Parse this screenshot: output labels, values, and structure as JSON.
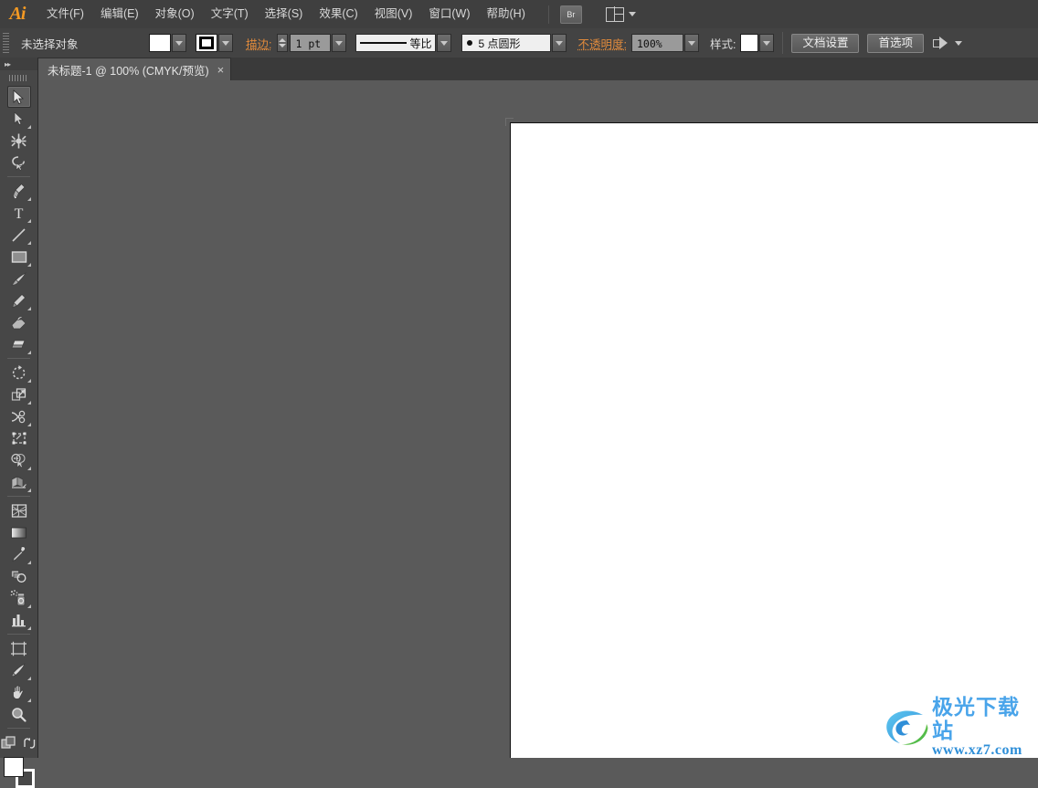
{
  "app": {
    "name": "Adobe Illustrator",
    "logo_text": "Ai"
  },
  "menubar": {
    "items": [
      {
        "label": "文件(F)",
        "name": "menu-file"
      },
      {
        "label": "编辑(E)",
        "name": "menu-edit"
      },
      {
        "label": "对象(O)",
        "name": "menu-object"
      },
      {
        "label": "文字(T)",
        "name": "menu-type"
      },
      {
        "label": "选择(S)",
        "name": "menu-select"
      },
      {
        "label": "效果(C)",
        "name": "menu-effect"
      },
      {
        "label": "视图(V)",
        "name": "menu-view"
      },
      {
        "label": "窗口(W)",
        "name": "menu-window"
      },
      {
        "label": "帮助(H)",
        "name": "menu-help"
      }
    ],
    "bridge_label": "Br",
    "workspace_label": ""
  },
  "controlbar": {
    "selection_status": "未选择对象",
    "fill_color": "#ffffff",
    "stroke_color": "#000000",
    "stroke_label": "描边:",
    "stroke_weight": "1 pt",
    "stroke_profile": "等比",
    "brush_definition": "5 点圆形",
    "opacity_label": "不透明度:",
    "opacity_value": "100%",
    "style_label": "样式:",
    "style_color": "#ffffff",
    "document_setup_button": "文档设置",
    "preferences_button": "首选项"
  },
  "tabbar": {
    "tabs": [
      {
        "title": "未标题-1 @ 100% (CMYK/预览)",
        "close": "×"
      }
    ]
  },
  "toolbar": {
    "collapse_arrows": "▸▸",
    "tools": [
      {
        "name": "selection-tool",
        "label": "选择工具",
        "selected": true,
        "hidden": false
      },
      {
        "name": "direct-selection-tool",
        "label": "直接选择工具",
        "selected": false,
        "hidden": true
      },
      {
        "name": "magic-wand-tool",
        "label": "魔棒工具",
        "selected": false,
        "hidden": false
      },
      {
        "name": "lasso-tool",
        "label": "套索工具",
        "selected": false,
        "hidden": false
      },
      {
        "name": "pen-tool",
        "label": "钢笔工具",
        "selected": false,
        "hidden": true
      },
      {
        "name": "type-tool",
        "label": "文字工具",
        "selected": false,
        "hidden": true
      },
      {
        "name": "line-segment-tool",
        "label": "直线段工具",
        "selected": false,
        "hidden": true
      },
      {
        "name": "rectangle-tool",
        "label": "矩形工具",
        "selected": false,
        "hidden": true
      },
      {
        "name": "paintbrush-tool",
        "label": "画笔工具",
        "selected": false,
        "hidden": false
      },
      {
        "name": "pencil-tool",
        "label": "铅笔工具",
        "selected": false,
        "hidden": true
      },
      {
        "name": "blob-brush-tool",
        "label": "斑点画笔工具",
        "selected": false,
        "hidden": false
      },
      {
        "name": "eraser-tool",
        "label": "橡皮擦工具",
        "selected": false,
        "hidden": true
      },
      {
        "name": "rotate-tool",
        "label": "旋转工具",
        "selected": false,
        "hidden": true
      },
      {
        "name": "scale-tool",
        "label": "比例缩放工具",
        "selected": false,
        "hidden": true
      },
      {
        "name": "width-tool",
        "label": "宽度工具",
        "selected": false,
        "hidden": true
      },
      {
        "name": "free-transform-tool",
        "label": "自由变换工具",
        "selected": false,
        "hidden": false
      },
      {
        "name": "shape-builder-tool",
        "label": "形状生成器工具",
        "selected": false,
        "hidden": true
      },
      {
        "name": "graph-tool",
        "label": "柱形图工具",
        "selected": false,
        "hidden": true
      },
      {
        "name": "perspective-grid-tool",
        "label": "透视网格工具",
        "selected": false,
        "hidden": true
      },
      {
        "name": "mesh-tool",
        "label": "网格工具",
        "selected": false,
        "hidden": false
      },
      {
        "name": "gradient-tool",
        "label": "渐变工具",
        "selected": false,
        "hidden": false
      },
      {
        "name": "eyedropper-tool",
        "label": "吸管工具",
        "selected": false,
        "hidden": true
      },
      {
        "name": "blend-tool",
        "label": "混合工具",
        "selected": false,
        "hidden": false
      },
      {
        "name": "symbol-sprayer-tool",
        "label": "符号喷枪工具",
        "selected": false,
        "hidden": true
      },
      {
        "name": "column-graph-tool",
        "label": "柱形图工具",
        "selected": false,
        "hidden": true
      },
      {
        "name": "artboard-tool",
        "label": "画板工具",
        "selected": false,
        "hidden": false
      },
      {
        "name": "slice-tool",
        "label": "切片工具",
        "selected": false,
        "hidden": true
      },
      {
        "name": "hand-tool",
        "label": "抓手工具",
        "selected": false,
        "hidden": true
      },
      {
        "name": "zoom-tool",
        "label": "缩放工具",
        "selected": false,
        "hidden": false
      }
    ],
    "fill_color": "#ffffff",
    "stroke_color": "#ffffff"
  },
  "canvas": {
    "artboard_color": "#ffffff",
    "background_color": "#5a5a5a"
  },
  "watermark": {
    "site_name": "极光下载站",
    "url": "www.xz7.com"
  }
}
